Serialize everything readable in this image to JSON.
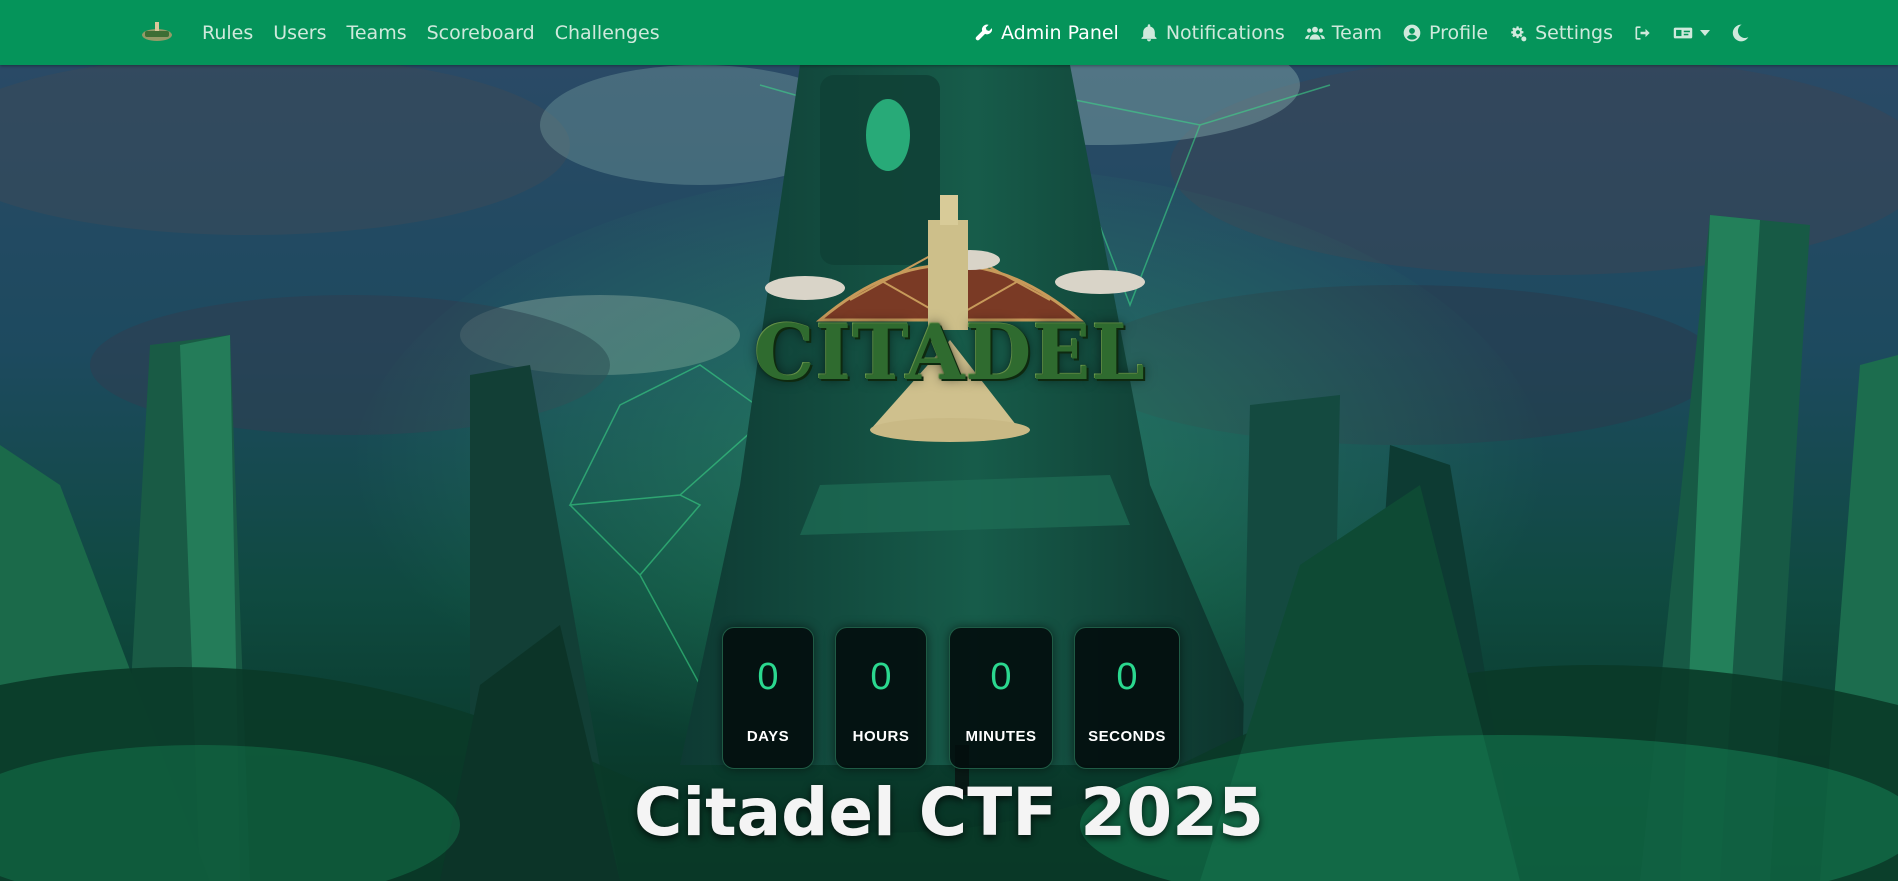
{
  "navbar": {
    "brand_icon": "citadel-logo-icon",
    "left_links": [
      "Rules",
      "Users",
      "Teams",
      "Scoreboard",
      "Challenges"
    ],
    "admin_panel": "Admin Panel",
    "notifications": "Notifications",
    "team": "Team",
    "profile": "Profile",
    "settings": "Settings",
    "icons": {
      "admin_panel": "wrench-icon",
      "notifications": "bell-icon",
      "team": "users-icon",
      "profile": "user-circle-icon",
      "settings": "gears-icon",
      "logout": "sign-out-icon",
      "language": "language-icon",
      "theme": "moon-icon"
    }
  },
  "logo": {
    "wordmark": "CITADEL"
  },
  "countdown": [
    {
      "value": "0",
      "label": "DAYS"
    },
    {
      "value": "0",
      "label": "HOURS"
    },
    {
      "value": "0",
      "label": "MINUTES"
    },
    {
      "value": "0",
      "label": "SECONDS"
    }
  ],
  "title": "Citadel CTF 2025",
  "colors": {
    "navbar": "#05945a",
    "accent": "#2bd88f"
  }
}
